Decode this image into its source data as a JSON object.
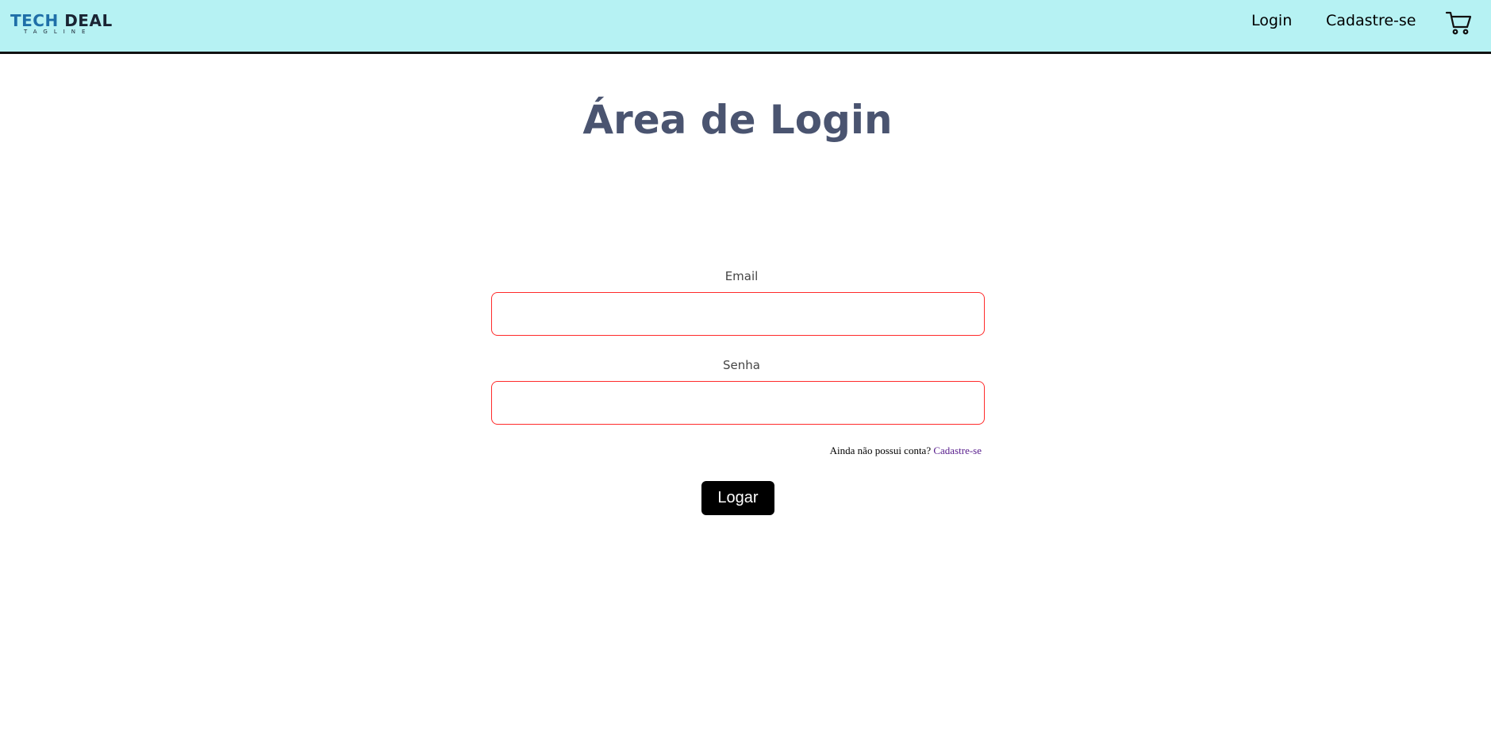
{
  "header": {
    "logo": {
      "brand_part1": "TECH",
      "brand_part2": "DEAL",
      "tagline": "TAGLINE"
    },
    "nav": {
      "login_label": "Login",
      "signup_label": "Cadastre-se"
    },
    "cart_icon": "shopping-cart-icon"
  },
  "main": {
    "title": "Área de Login",
    "form": {
      "email_label": "Email",
      "email_value": "",
      "password_label": "Senha",
      "password_value": "",
      "signup_prompt": "Ainda não possui conta?",
      "signup_link": "Cadastre-se",
      "submit_label": "Logar"
    }
  },
  "colors": {
    "header_bg": "#b6f2f3",
    "title": "#4a5470",
    "input_border": "#ff2b2b",
    "link": "#551a8b",
    "button_bg": "#000000",
    "logo_blue": "#1f6fa8"
  }
}
